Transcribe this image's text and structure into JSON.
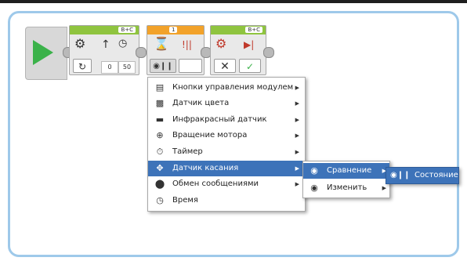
{
  "colors": {
    "accent_blue": "#3d73b9",
    "start_green": "#3bb24a",
    "block_green": "#8fc43f",
    "wait_orange": "#f2a22a",
    "frame_border": "#9ec9ea"
  },
  "blocks": {
    "start": {
      "icon": "play-icon"
    },
    "move_steering": {
      "port": "B+C",
      "mode_icon": "loop-icon",
      "steering": "0",
      "power": "50"
    },
    "wait": {
      "port": "1",
      "mode_icon": "touch-compare-icon"
    },
    "stop": {
      "port": "B+C",
      "off_icon": "x-icon",
      "brake_icon": "check-icon"
    }
  },
  "menu": {
    "items": [
      {
        "icon": "brick-buttons-icon",
        "label": "Кнопки управления модулем"
      },
      {
        "icon": "color-sensor-icon",
        "label": "Датчик цвета"
      },
      {
        "icon": "infrared-sensor-icon",
        "label": "Инфракрасный датчик"
      },
      {
        "icon": "motor-rotation-icon",
        "label": "Вращение мотора"
      },
      {
        "icon": "timer-icon",
        "label": "Таймер"
      },
      {
        "icon": "touch-sensor-icon",
        "label": "Датчик касания"
      },
      {
        "icon": "bluetooth-icon",
        "label": "Обмен сообщениями"
      },
      {
        "icon": "time-icon",
        "label": "Время"
      }
    ],
    "selected_index": 5
  },
  "submenu": {
    "items": [
      {
        "icon": "compare-icon",
        "label": "Сравнение"
      },
      {
        "icon": "change-icon",
        "label": "Изменить"
      }
    ],
    "selected_index": 0
  },
  "submenu3": {
    "icon": "touch-state-icon",
    "label": "Состояние"
  }
}
